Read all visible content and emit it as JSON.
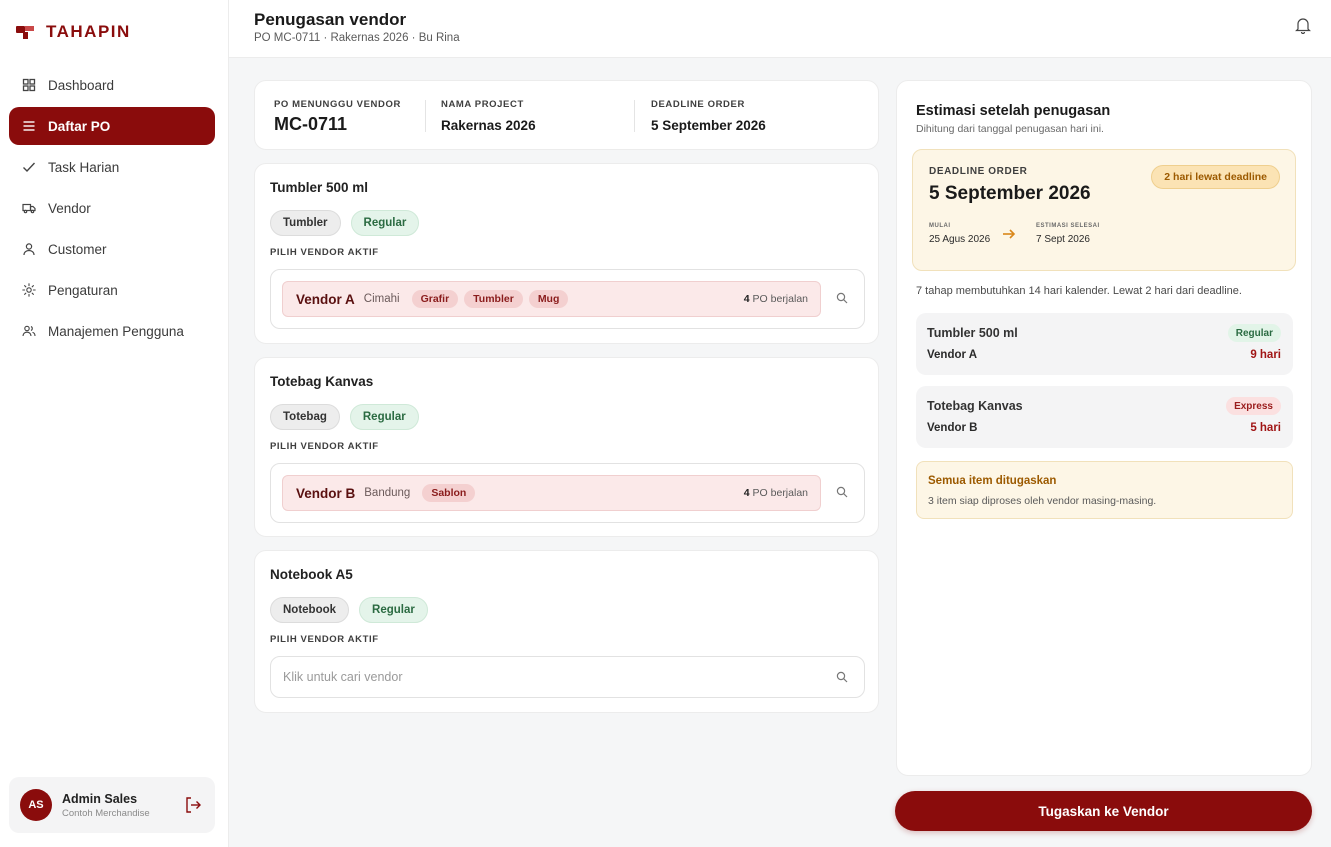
{
  "app": {
    "name": "TAHAPIN"
  },
  "sidebar": {
    "items": [
      {
        "label": "Dashboard",
        "icon": "grid-icon"
      },
      {
        "label": "Daftar PO",
        "icon": "list-icon",
        "active": true
      },
      {
        "label": "Task Harian",
        "icon": "check-icon"
      },
      {
        "label": "Vendor",
        "icon": "truck-icon"
      },
      {
        "label": "Customer",
        "icon": "user-icon"
      },
      {
        "label": "Pengaturan",
        "icon": "gear-icon"
      },
      {
        "label": "Manajemen Pengguna",
        "icon": "users-icon"
      }
    ]
  },
  "user": {
    "initials": "AS",
    "name": "Admin Sales",
    "company": "Contoh Merchandise"
  },
  "header": {
    "title": "Penugasan vendor",
    "subtitle": "PO MC-0711 · Rakernas 2026 · Bu Rina"
  },
  "summary": {
    "po_label": "PO MENUNGGU VENDOR",
    "po_value": "MC-0711",
    "project_label": "NAMA PROJECT",
    "project_value": "Rakernas 2026",
    "deadline_label": "DEADLINE ORDER",
    "deadline_value": "5 September 2026"
  },
  "pick_vendor_label": "PILIH VENDOR AKTIF",
  "items": [
    {
      "title": "Tumbler 500 ml",
      "tags": [
        "Tumbler",
        "Regular"
      ],
      "vendor": {
        "name": "Vendor A",
        "city": "Cimahi",
        "skills": [
          "Grafir",
          "Tumbler",
          "Mug"
        ],
        "po_count": "4",
        "po_label": "PO berjalan"
      }
    },
    {
      "title": "Totebag Kanvas",
      "tags": [
        "Totebag",
        "Regular"
      ],
      "vendor": {
        "name": "Vendor B",
        "city": "Bandung",
        "skills": [
          "Sablon"
        ],
        "po_count": "4",
        "po_label": "PO berjalan"
      }
    },
    {
      "title": "Notebook A5",
      "tags": [
        "Notebook",
        "Regular"
      ],
      "search_placeholder": "Klik untuk cari vendor"
    }
  ],
  "estimate": {
    "title": "Estimasi setelah penugasan",
    "subtitle": "Dihitung dari tanggal penugasan hari ini.",
    "deadline_label": "DEADLINE ORDER",
    "deadline_date": "5 September 2026",
    "late_badge": "2 hari lewat deadline",
    "start_label": "MULAI",
    "start_value": "25 Agus 2026",
    "end_label": "ESTIMASI SELESAI",
    "end_value": "7 Sept 2026",
    "note": "7 tahap membutuhkan 14 hari kalender. Lewat 2 hari dari deadline.",
    "rows": [
      {
        "title": "Tumbler 500 ml",
        "vendor": "Vendor A",
        "badge": "Regular",
        "days": "9 hari"
      },
      {
        "title": "Totebag Kanvas",
        "vendor": "Vendor B",
        "badge": "Express",
        "days": "5 hari"
      }
    ],
    "done_title": "Semua item ditugaskan",
    "done_sub": "3 item siap diproses oleh vendor masing-masing."
  },
  "actions": {
    "assign_label": "Tugaskan ke Vendor"
  },
  "colors": {
    "brand": "#8a0c0c",
    "warning": "#9c5a00",
    "success": "#2b6b42"
  }
}
